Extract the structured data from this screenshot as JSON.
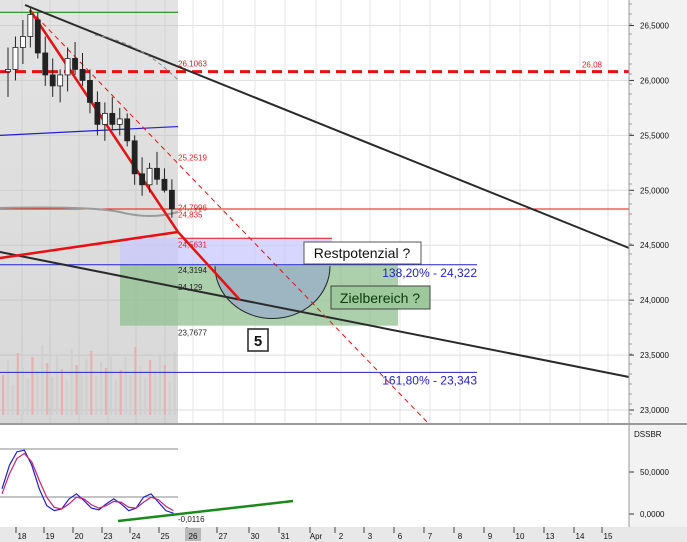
{
  "chart_data": {
    "type": "candlestick",
    "price_axis": {
      "ticks": [
        "26,5000",
        "26,0000",
        "25,5000",
        "25,0000",
        "24,5000",
        "24,0000",
        "23,5000",
        "23,0000"
      ],
      "tick_values": [
        26.5,
        26.0,
        25.5,
        25.0,
        24.5,
        24.0,
        23.5,
        23.0
      ],
      "ylim": [
        22.93,
        26.73
      ],
      "grid": true
    },
    "oscillator_axis": {
      "name": "DSSBR",
      "ticks": [
        "50,0000",
        "0,0000"
      ],
      "tick_values": [
        50,
        0
      ],
      "ylim": [
        -12,
        88
      ]
    },
    "date_axis": {
      "labels": [
        "18",
        "19",
        "20",
        "23",
        "24",
        "25",
        "26",
        "27",
        "30",
        "31",
        "Apr",
        "2",
        "3",
        "6",
        "7",
        "8",
        "9",
        "10",
        "13",
        "14",
        "15"
      ],
      "highlight_label": "26"
    },
    "candles": [
      {
        "o": 26.08,
        "h": 26.3,
        "l": 25.85,
        "c": 26.1
      },
      {
        "o": 26.1,
        "h": 26.4,
        "l": 26.0,
        "c": 26.3
      },
      {
        "o": 26.3,
        "h": 26.55,
        "l": 26.15,
        "c": 26.4
      },
      {
        "o": 26.4,
        "h": 26.66,
        "l": 26.3,
        "c": 26.6
      },
      {
        "o": 26.55,
        "h": 26.62,
        "l": 26.2,
        "c": 26.25
      },
      {
        "o": 26.25,
        "h": 26.4,
        "l": 25.95,
        "c": 26.05
      },
      {
        "o": 26.05,
        "h": 26.2,
        "l": 25.85,
        "c": 25.95
      },
      {
        "o": 25.95,
        "h": 26.1,
        "l": 25.8,
        "c": 26.05
      },
      {
        "o": 26.05,
        "h": 26.3,
        "l": 25.9,
        "c": 26.2
      },
      {
        "o": 26.2,
        "h": 26.35,
        "l": 26.05,
        "c": 26.1
      },
      {
        "o": 26.1,
        "h": 26.25,
        "l": 25.95,
        "c": 26.0
      },
      {
        "o": 26.0,
        "h": 26.1,
        "l": 25.7,
        "c": 25.8
      },
      {
        "o": 25.8,
        "h": 25.9,
        "l": 25.5,
        "c": 25.6
      },
      {
        "o": 25.6,
        "h": 25.8,
        "l": 25.45,
        "c": 25.7
      },
      {
        "o": 25.7,
        "h": 25.85,
        "l": 25.55,
        "c": 25.6
      },
      {
        "o": 25.6,
        "h": 25.75,
        "l": 25.5,
        "c": 25.65
      },
      {
        "o": 25.65,
        "h": 25.7,
        "l": 25.4,
        "c": 25.45
      },
      {
        "o": 25.45,
        "h": 25.5,
        "l": 25.05,
        "c": 25.15
      },
      {
        "o": 25.15,
        "h": 25.3,
        "l": 24.95,
        "c": 25.05
      },
      {
        "o": 25.05,
        "h": 25.25,
        "l": 24.98,
        "c": 25.2
      },
      {
        "o": 25.2,
        "h": 25.35,
        "l": 25.05,
        "c": 25.1
      },
      {
        "o": 25.1,
        "h": 25.2,
        "l": 24.98,
        "c": 25.0
      },
      {
        "o": 25.0,
        "h": 25.1,
        "l": 24.75,
        "c": 24.83
      }
    ],
    "levels": [
      {
        "label": "26,1063",
        "value": 26.1063,
        "color": "#c8202a"
      },
      {
        "label": "25,2519",
        "value": 25.2519,
        "color": "#e0202a"
      },
      {
        "label": "24,7996",
        "value": 24.7996,
        "color": "#e0202a"
      },
      {
        "label": "24,835",
        "value": 24.835,
        "color": "#e0202a"
      },
      {
        "label": "24,5631",
        "value": 24.5631,
        "color": "#e0202a"
      },
      {
        "label": "24,3194",
        "value": 24.3194,
        "color": "#222222"
      },
      {
        "label": "24,129",
        "value": 24.129,
        "color": "#222222"
      },
      {
        "label": "23,7677",
        "value": 23.7677,
        "color": "#222222"
      },
      {
        "label": "26,08",
        "value": 26.08,
        "color": "#e0202a"
      },
      {
        "label": "-0,0116",
        "value": -0.0116,
        "color": "#222222"
      }
    ],
    "fib_levels": [
      {
        "label": "138,20% - 24,322",
        "value": 24.322,
        "color": "#2222cc"
      },
      {
        "label": "161,80% - 23,343",
        "value": 23.343,
        "color": "#2222cc"
      }
    ],
    "annotations": [
      {
        "text": "Restpotenzial ?",
        "style": "box"
      },
      {
        "text": "Zielbereich ?",
        "style": "box-green"
      },
      {
        "text": "5",
        "style": "wave-count"
      }
    ],
    "oscillator_series": [
      {
        "color": "#2020cc",
        "values": [
          30,
          58,
          74,
          76,
          58,
          30,
          10,
          4,
          6,
          18,
          24,
          16,
          7,
          5,
          12,
          18,
          12,
          4,
          7,
          20,
          24,
          14,
          4,
          1
        ]
      },
      {
        "color": "#cc2070",
        "values": [
          24,
          48,
          66,
          72,
          62,
          40,
          20,
          8,
          6,
          12,
          20,
          18,
          11,
          7,
          10,
          15,
          14,
          8,
          7,
          14,
          20,
          17,
          9,
          4
        ]
      }
    ],
    "colors": {
      "bullish_candle": "#ffffff",
      "bearish_candle": "#222222",
      "red_trend": "#e81010",
      "dashed_resistance": "#e81010",
      "shaded_history": "#b8b8b8",
      "blue_zone": "#c8c8ff",
      "green_zone": "#8fc08f"
    }
  }
}
